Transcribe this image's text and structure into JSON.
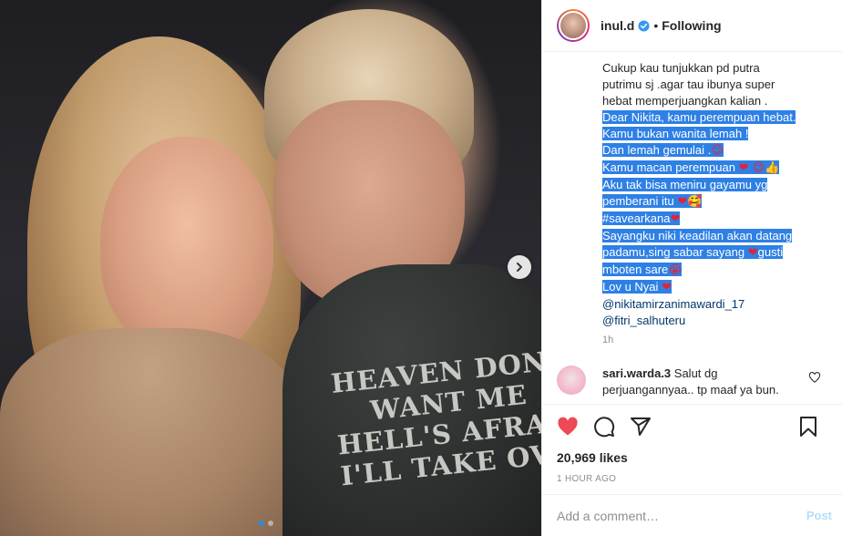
{
  "post": {
    "username": "inul.d",
    "follow_separator": "•",
    "follow_status": "Following"
  },
  "photo": {
    "shirt_text_lines": [
      "HEAVEN DON'T",
      "WANT ME",
      "HELL'S AFRAID",
      "I'LL TAKE OV"
    ]
  },
  "caption": {
    "lines": [
      {
        "text": "Cukup kau tunjukkan pd putra",
        "selected": false
      },
      {
        "text": "putrimu sj .agar tau ibunya super",
        "selected": false
      },
      {
        "text": "hebat memperjuangkan kalian .",
        "selected": false
      },
      {
        "text": "Dear Nikita, kamu perempuan hebat.",
        "selected": true
      },
      {
        "text": "Kamu bukan wanita lemah !",
        "selected": true
      },
      {
        "text": "Dan lemah gemulai .",
        "selected": true,
        "emoji": "😉"
      },
      {
        "text": "Kamu macan perempuan ",
        "selected": true,
        "emoji": "❤ 😉👍"
      },
      {
        "text": "Aku tak bisa meniru gayamu yg",
        "selected": true
      },
      {
        "text": "pemberani itu ",
        "selected": true,
        "emoji": "❤🥰"
      },
      {
        "text": "#savearkana",
        "selected": true,
        "emoji": "❤"
      },
      {
        "text": "Sayangku niki keadilan akan datang",
        "selected": true
      },
      {
        "text": "padamu,sing sabar sayang ",
        "selected": true,
        "emoji": "❤",
        "tail": "gusti"
      },
      {
        "text": "mboten sare",
        "selected": true,
        "emoji": "😭"
      },
      {
        "text": "Lov u Nyai ",
        "selected": true,
        "emoji": "❤"
      }
    ],
    "mentions": [
      "@nikitamirzanimawardi_17",
      "@fitri_salhuteru"
    ],
    "time": "1h"
  },
  "comment": {
    "username": "sari.warda.3",
    "text": "Salut dg perjuangannyaa.. tp maaf ya bun."
  },
  "actions": {
    "icons": [
      "heart-filled-icon",
      "comment-icon",
      "share-icon",
      "bookmark-icon"
    ],
    "like_color": "#ed4956"
  },
  "likes": "20,969 likes",
  "timestamp": "1 HOUR AGO",
  "add_comment": {
    "placeholder": "Add a comment…",
    "post_label": "Post"
  },
  "carousel": {
    "dot_count": 2,
    "active_index": 0
  }
}
